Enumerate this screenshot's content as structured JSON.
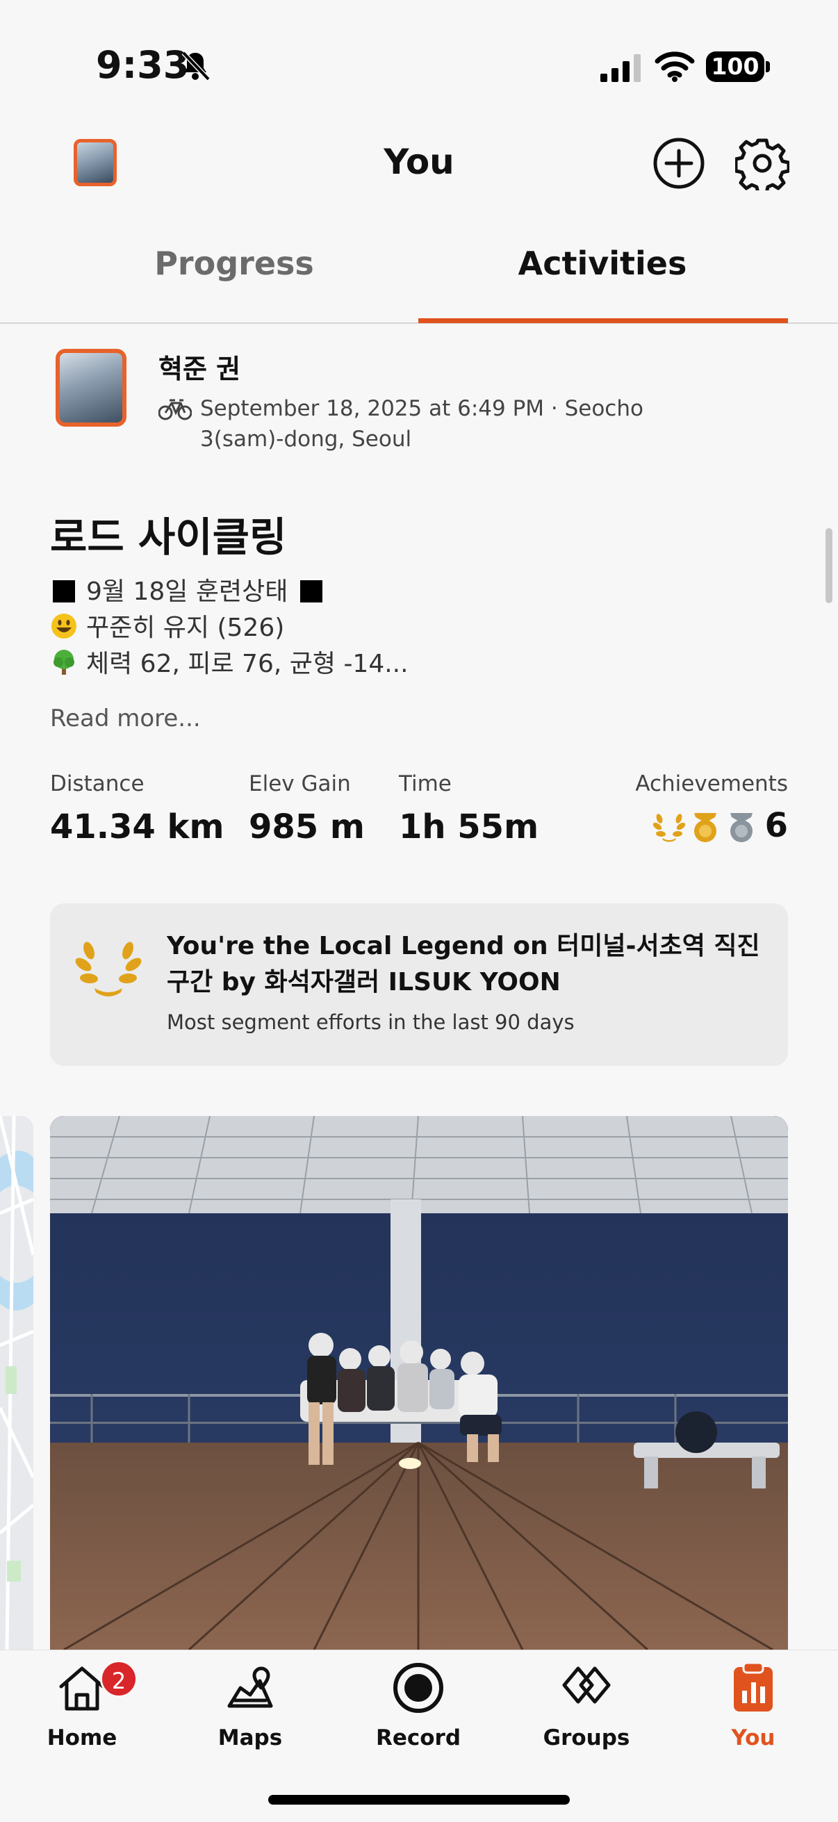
{
  "status": {
    "time": "9:33",
    "battery": "100"
  },
  "header": {
    "title": "You"
  },
  "tabs": [
    {
      "label": "Progress"
    },
    {
      "label": "Activities"
    }
  ],
  "activity": {
    "athlete_name": "혁준 권",
    "meta": "September 18, 2025 at 6:49 PM · Seocho 3(sam)-dong, Seoul",
    "title": "로드 사이클링",
    "description": [
      "9월 18일 훈련상태",
      "꾸준히 유지 (526)",
      "체력 62, 피로 76, 균형 -14..."
    ],
    "read_more": "Read more...",
    "stats": {
      "distance_label": "Distance",
      "distance_value": "41.34 km",
      "elev_label": "Elev Gain",
      "elev_value": "985 m",
      "time_label": "Time",
      "time_value": "1h 55m",
      "achievements_label": "Achievements",
      "achievements_count": "6"
    },
    "local_legend": {
      "title": "You're the Local Legend on 터미널-서초역 직진구간 by 화석자갤러 ILSUK YOON",
      "subtitle": "Most segment efforts in the last 90 days"
    }
  },
  "nav": {
    "home": "Home",
    "home_badge": "2",
    "maps": "Maps",
    "record": "Record",
    "groups": "Groups",
    "you": "You"
  },
  "colors": {
    "accent": "#e0531f",
    "gold": "#e0a21a",
    "silver": "#8a949c"
  }
}
